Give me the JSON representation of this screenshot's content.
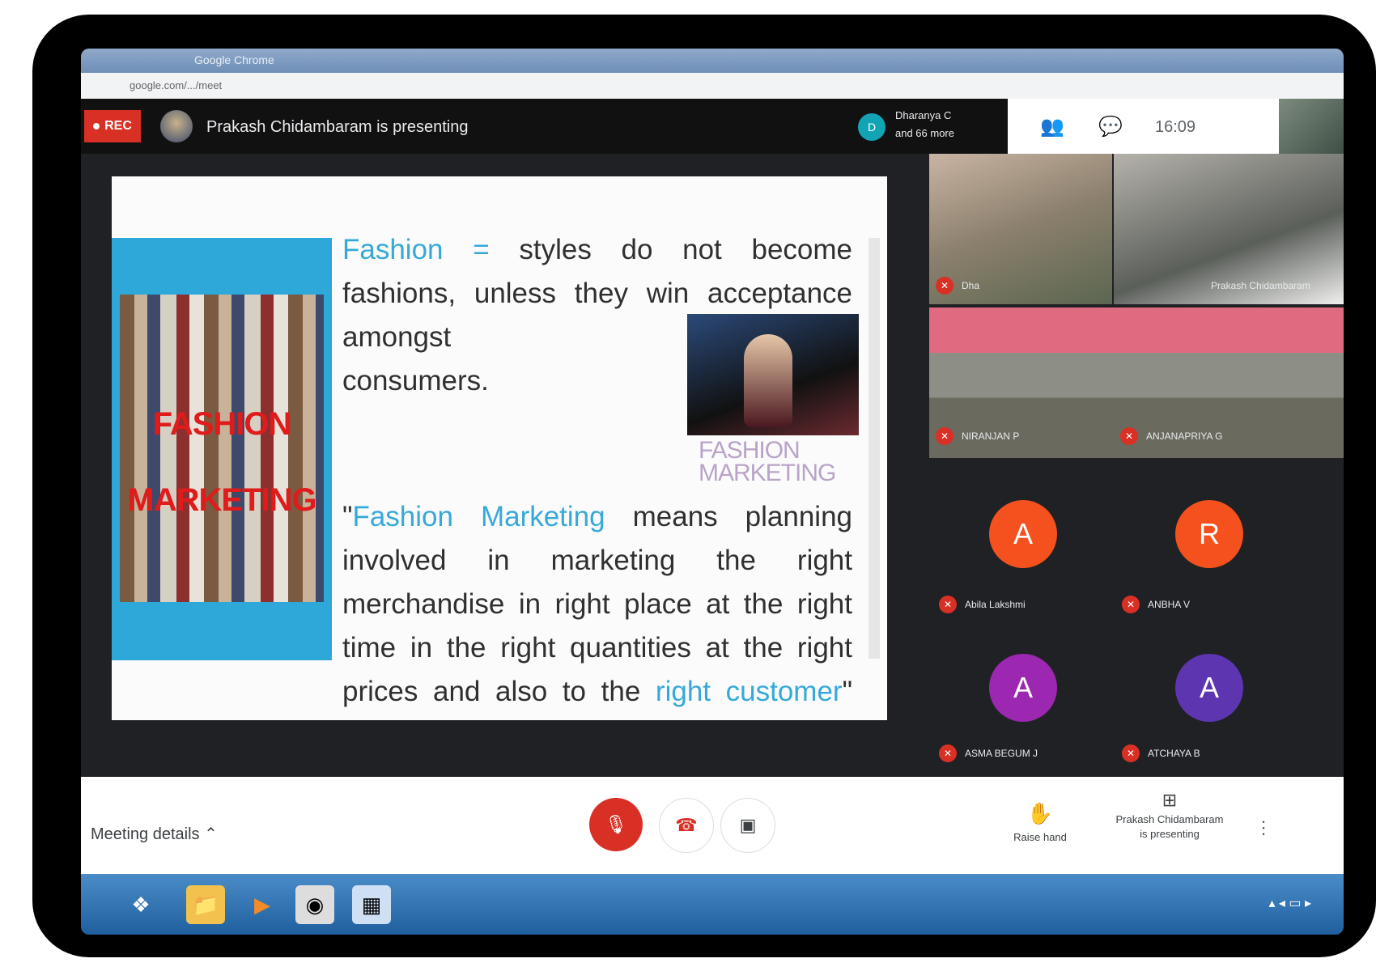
{
  "window": {
    "title": "Google Chrome",
    "url": "google.com/.../meet"
  },
  "topbar": {
    "rec_label": "REC",
    "presenting_text": "Prakash Chidambaram is presenting",
    "joined_avatar": "D",
    "joined_name": "Dharanya C",
    "joined_more": "and 66 more",
    "clock": "16:09"
  },
  "slide": {
    "collage_word1": "FASHION",
    "collage_word2": "MARKETING",
    "def1_term": "Fashion =",
    "def1_rest": " styles do not become fashions, unless they win acceptance amongst",
    "def1_last": "consumers.",
    "photo_caption_1": "FASHION",
    "photo_caption_2": "MARKETING",
    "def2_open": "\"",
    "def2_term": "Fashion Marketing",
    "def2_rest": " means planning involved in marketing the right merchandise in right place at the right time in the right quantities at the right prices and also to the ",
    "def2_end": "right customer",
    "def2_close": "\""
  },
  "participants": [
    {
      "name": "Dha"
    },
    {
      "name": "Prakash Chidambaram"
    },
    {
      "name": "NIRANJAN P"
    },
    {
      "name": "ANJANAPRIYA G"
    },
    {
      "name": "Abila Lakshmi",
      "initial": "A",
      "color": "#f4511e"
    },
    {
      "name": "ANBHA V",
      "initial": "R",
      "color": "#f4511e"
    },
    {
      "name": "ASMA BEGUM J",
      "initial": "A",
      "color": "#9c27b0"
    },
    {
      "name": "ATCHAYA B",
      "initial": "A",
      "color": "#5e35b1"
    }
  ],
  "bottombar": {
    "meeting_details": "Meeting details",
    "raise_hand": "Raise hand",
    "presenting_line1": "Prakash Chidambaram",
    "presenting_line2": "is presenting"
  },
  "icons": {
    "people": "people-icon",
    "chat": "chat-icon",
    "mic_off": "mic-off-icon",
    "hangup": "hangup-icon",
    "camera": "camera-icon",
    "hand": "raise-hand-icon",
    "present": "present-icon",
    "more": "more-icon"
  }
}
